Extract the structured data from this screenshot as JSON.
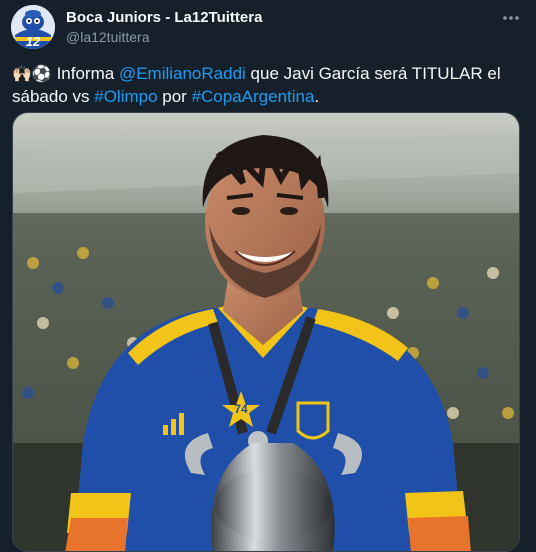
{
  "account": {
    "display_name": "Boca Juniors - La12Tuittera",
    "handle": "@la12tuittera",
    "avatar_label": "12"
  },
  "tweet": {
    "emoji_prefix": "🙌🏻⚽",
    "t1": " Informa ",
    "mention": "@EmilianoRaddi",
    "t2": " que Javi García será TITULAR el sábado vs ",
    "hashtag1": "#Olimpo",
    "t3": " por ",
    "hashtag2": "#CopaArgentina",
    "t4": "."
  },
  "media": {
    "jersey_number": "74"
  },
  "colors": {
    "background": "#15202b",
    "link": "#1d9bf0",
    "muted": "#8b98a5",
    "boca_blue": "#1f4fa8",
    "boca_gold": "#f2c418"
  }
}
